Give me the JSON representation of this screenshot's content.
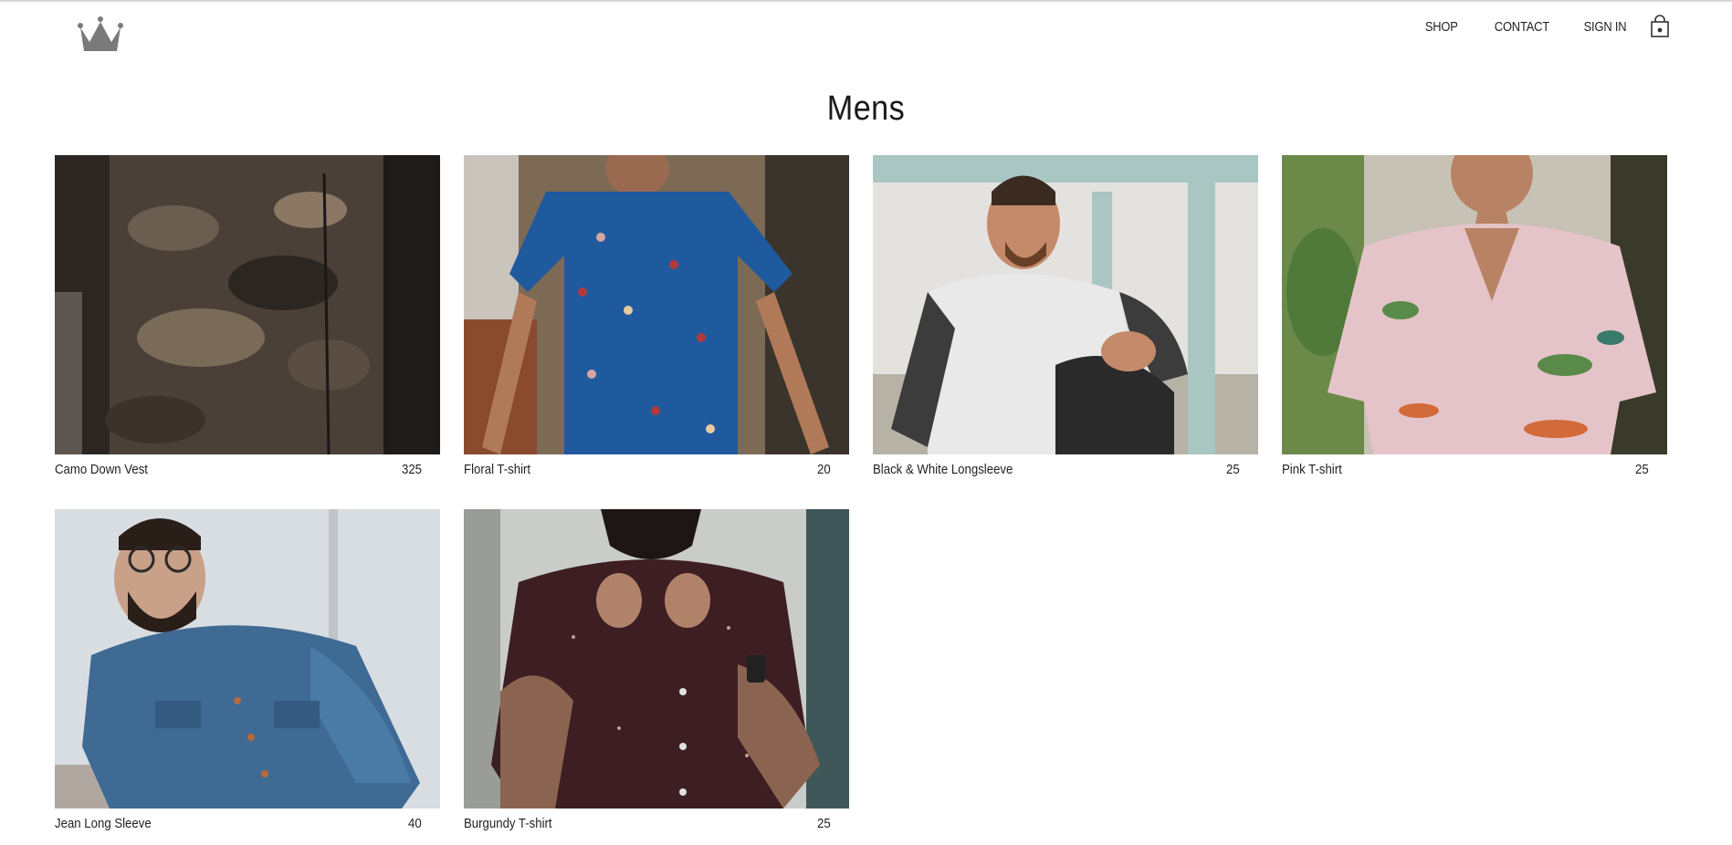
{
  "header": {
    "logo_icon": "crown-icon",
    "nav": [
      {
        "label": "SHOP"
      },
      {
        "label": "CONTACT"
      },
      {
        "label": "SIGN IN"
      }
    ],
    "cart_icon": "shopping-bag-icon"
  },
  "page": {
    "title": "Mens"
  },
  "products": [
    {
      "name": "Camo Down Vest",
      "price": "325"
    },
    {
      "name": "Floral T-shirt",
      "price": "20"
    },
    {
      "name": "Black & White Longsleeve",
      "price": "25"
    },
    {
      "name": "Pink T-shirt",
      "price": "25"
    },
    {
      "name": "Jean Long Sleeve",
      "price": "40"
    },
    {
      "name": "Burgundy T-shirt",
      "price": "25"
    }
  ]
}
